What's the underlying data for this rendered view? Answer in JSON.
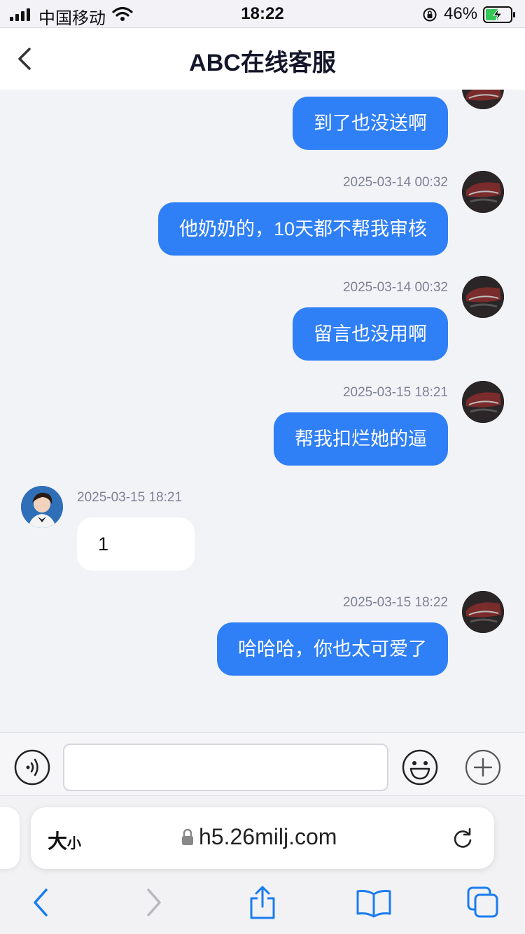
{
  "status_bar": {
    "carrier": "中国移动",
    "time": "18:22",
    "battery": "46%"
  },
  "header": {
    "title": "ABC在线客服"
  },
  "messages": [
    {
      "direction": "out",
      "timestamp": "",
      "text": "到了也没送啊"
    },
    {
      "direction": "out",
      "timestamp": "2025-03-14 00:32",
      "text": "他奶奶的，10天都不帮我审核"
    },
    {
      "direction": "out",
      "timestamp": "2025-03-14 00:32",
      "text": "留言也没用啊"
    },
    {
      "direction": "out",
      "timestamp": "2025-03-15 18:21",
      "text": "帮我扣烂她的逼"
    },
    {
      "direction": "in",
      "timestamp": "2025-03-15 18:21",
      "text": "1"
    },
    {
      "direction": "out",
      "timestamp": "2025-03-15 18:22",
      "text": "哈哈哈，你也太可爱了"
    }
  ],
  "input": {
    "placeholder": ""
  },
  "browser": {
    "text_size_label": "大",
    "text_size_label_small": "小",
    "url": "h5.26milj.com"
  },
  "colors": {
    "outgoing_bubble": "#2f7ff6",
    "link_blue": "#1a7cf0"
  }
}
